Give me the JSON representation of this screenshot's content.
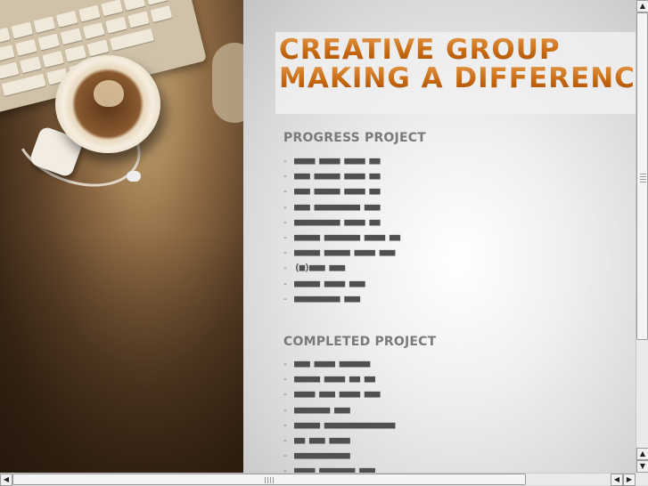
{
  "headline": {
    "line1": "CREATIVE GROUP",
    "line2": "MAKING A DIFFERENC"
  },
  "progress": {
    "title": "PROGRESS PROJECT",
    "items": [
      "■■■■ ■■■■ ■■■■ ■■",
      "■■■ ■■■■■ ■■■■ ■■",
      "■■■ ■■■■■ ■■■■ ■■",
      "■■■ ■■■■■■■■■ ■■■",
      "■■■■■■■■■ ■■■■ ■■",
      "■■■■■ ■■■■■■■ ■■■■ ■■",
      "■■■■■ ■■■■■ ■■■■ ■■■",
      "(■)■■■ ■■■",
      "■■■■■ ■■■■ ■■■",
      "■■■■■■■■■ ■■■"
    ]
  },
  "completed": {
    "title": "COMPLETED PROJECT",
    "items": [
      "■■■ ■■■■ ■■■■■■",
      "■■■■■ ■■■■ ■■ ■■",
      "■■■■ ■■■ ■■■■ ■■■",
      "■■■■■■■ ■■■",
      "■■■■■ ■■■■■■■■■■■■■■",
      "■■ ■■■ ■■■■",
      "■■■■■■■■■■■",
      "■■■■ ■■■■■■■ ■■■"
    ]
  },
  "bullet": "-",
  "scrollbar": {
    "up_arrow": "▲",
    "down_arrow": "▼",
    "left_arrow": "◀",
    "right_arrow": "▶"
  }
}
